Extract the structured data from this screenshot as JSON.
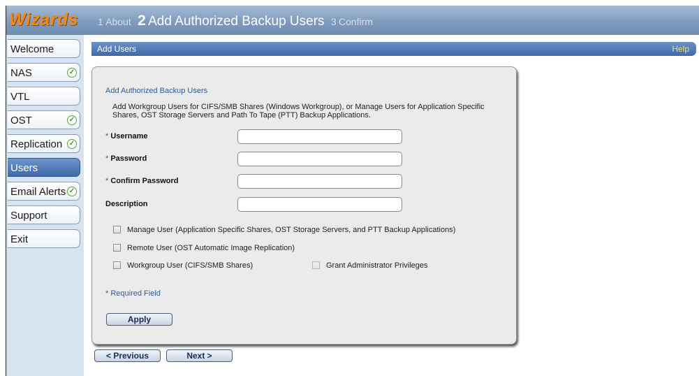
{
  "header": {
    "logo": "Wizards",
    "steps": [
      {
        "num": "1",
        "label": "About"
      },
      {
        "num": "2",
        "label": "Add Authorized Backup Users"
      },
      {
        "num": "3",
        "label": "Confirm"
      }
    ]
  },
  "sidebar": {
    "items": [
      {
        "label": "Welcome",
        "checked": false
      },
      {
        "label": "NAS",
        "checked": true
      },
      {
        "label": "VTL",
        "checked": false
      },
      {
        "label": "OST",
        "checked": true
      },
      {
        "label": "Replication",
        "checked": true
      },
      {
        "label": "Users",
        "checked": false,
        "active": true
      },
      {
        "label": "Email Alerts",
        "checked": true
      },
      {
        "label": "Support",
        "checked": false
      },
      {
        "label": "Exit",
        "checked": false
      }
    ],
    "check_glyph": "✓"
  },
  "titlebar": {
    "title": "Add Users",
    "help": "Help"
  },
  "form": {
    "section_title": "Add Authorized Backup Users",
    "description": "Add Workgroup Users for CIFS/SMB Shares (Windows Workgroup), or Manage Users for Application Specific Shares, OST Storage Servers and Path To Tape (PTT) Backup Applications.",
    "required_marker": "*",
    "fields": [
      {
        "label": "Username",
        "required": true,
        "value": ""
      },
      {
        "label": "Password",
        "required": true,
        "value": ""
      },
      {
        "label": "Confirm Password",
        "required": true,
        "value": ""
      },
      {
        "label": "Description",
        "required": false,
        "value": ""
      }
    ],
    "checkboxes": [
      {
        "label": "Manage User (Application Specific Shares, OST Storage Servers, and PTT Backup Applications)",
        "checked": false
      },
      {
        "label": "Remote User (OST Automatic Image Replication)",
        "checked": false
      },
      {
        "label": "Workgroup User (CIFS/SMB Shares)",
        "checked": false
      },
      {
        "label": "Grant Administrator Privileges",
        "checked": false,
        "disabled": true
      }
    ],
    "required_note": "* Required Field",
    "apply": "Apply"
  },
  "footer": {
    "previous": "< Previous",
    "next": "Next >"
  },
  "colors": {
    "accent": "#3e68a6",
    "logo": "#f08a1c",
    "help": "#f2e35a",
    "link": "#2b5aa3"
  }
}
